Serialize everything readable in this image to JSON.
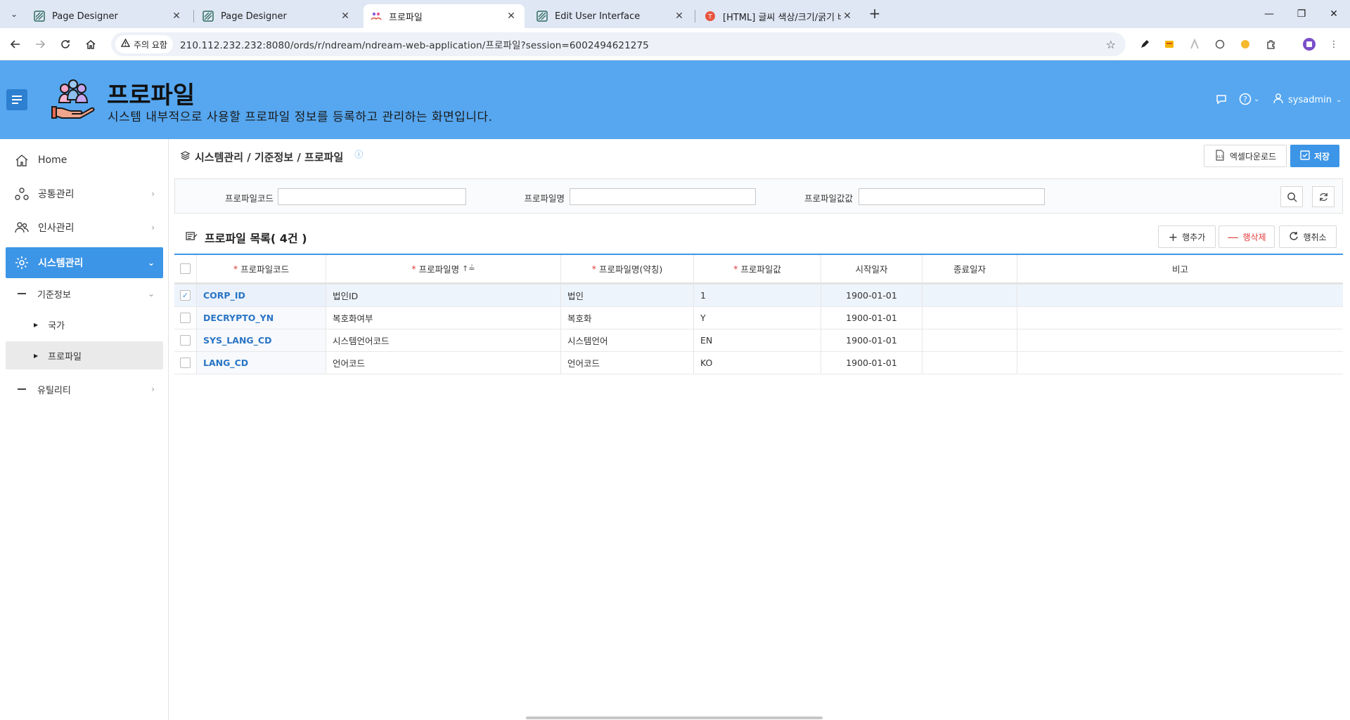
{
  "browser": {
    "tabs": [
      {
        "title": "Page Designer",
        "icon": "apex-icon",
        "active": false
      },
      {
        "title": "Page Designer",
        "icon": "apex-icon",
        "active": false
      },
      {
        "title": "프로파일",
        "icon": "app-icon",
        "active": true
      },
      {
        "title": "Edit User Interface",
        "icon": "apex-icon",
        "active": false
      },
      {
        "title": "[HTML] 글씨 색상/크기/굵기 바",
        "icon": "tistory-icon",
        "active": false
      }
    ],
    "security_chip": "주의 요함",
    "url": "210.112.232.232:8080/ords/r/ndream/ndream-web-application/프로파일?session=6002494621275"
  },
  "header": {
    "title": "프로파일",
    "subtitle": "시스템 내부적으로 사용할 프로파일 정보를 등록하고 관리하는 화면입니다.",
    "user": "sysadmin"
  },
  "sidebar": {
    "items": [
      {
        "label": "Home"
      },
      {
        "label": "공통관리"
      },
      {
        "label": "인사관리"
      },
      {
        "label": "시스템관리"
      }
    ],
    "sub": {
      "group": "기준정보",
      "children": [
        "국가",
        "프로파일"
      ],
      "utility": "유틸리티"
    }
  },
  "breadcrumb": "시스템관리 / 기준정보 / 프로파일",
  "actions": {
    "excel": "엑셀다운로드",
    "save": "저장"
  },
  "search": {
    "code_label": "프로파일코드",
    "name_label": "프로파일명",
    "value_label": "프로파일값값",
    "code_value": "",
    "name_value": "",
    "value_value": ""
  },
  "list": {
    "title": "프로파일 목록( 4건 )",
    "add_row": "행추가",
    "delete_row": "행삭제",
    "cancel_row": "행취소"
  },
  "grid": {
    "columns": [
      "프로파일코드",
      "프로파일명",
      "프로파일명(약칭)",
      "프로파일값",
      "시작일자",
      "종료일자",
      "비고"
    ],
    "sort_indicator": "↑≟",
    "rows": [
      {
        "checked": true,
        "code": "CORP_ID",
        "name": "법인ID",
        "short": "법인",
        "value": "1",
        "start": "1900-01-01",
        "end": "",
        "note": ""
      },
      {
        "checked": false,
        "code": "DECRYPTO_YN",
        "name": "복호화여부",
        "short": "복호화",
        "value": "Y",
        "start": "1900-01-01",
        "end": "",
        "note": ""
      },
      {
        "checked": false,
        "code": "SYS_LANG_CD",
        "name": "시스템언어코드",
        "short": "시스템언어",
        "value": "EN",
        "start": "1900-01-01",
        "end": "",
        "note": ""
      },
      {
        "checked": false,
        "code": "LANG_CD",
        "name": "언어코드",
        "short": "언어코드",
        "value": "KO",
        "start": "1900-01-01",
        "end": "",
        "note": ""
      }
    ]
  },
  "colors": {
    "header_bg": "#56a7f0",
    "accent": "#3c95e6",
    "danger": "#e23b3b"
  }
}
